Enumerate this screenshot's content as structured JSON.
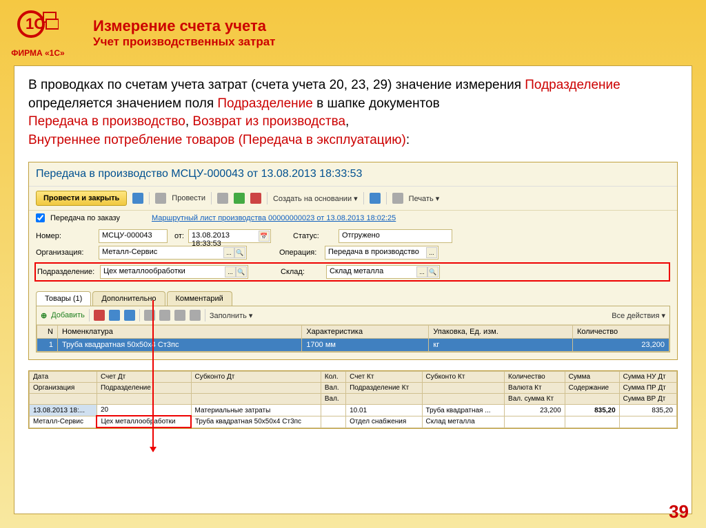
{
  "branding": {
    "company": "ФИРМА «1С»"
  },
  "header": {
    "title1": "Измерение счета учета",
    "title2": "Учет производственных затрат"
  },
  "intro": {
    "line1a": "В проводках по счетам учета затрат (счета учета 20, 23, 29) значение измерения ",
    "pod1": "Подразделение",
    "line1b": " определяется значением поля ",
    "pod2": "Подразделение",
    "line1c": " в шапке документов ",
    "doc1": "Передача в производство",
    "sep1": ", ",
    "doc2": "Возврат из производства",
    "sep2": ", ",
    "doc3": "Внутреннее потребление товаров (Передача в эксплуатацию)",
    "end": ":"
  },
  "window": {
    "title": "Передача в производство МСЦУ-000043 от 13.08.2013 18:33:53",
    "btn_post_close": "Провести и закрыть",
    "btn_post": "Провести",
    "btn_create_based": "Создать на основании ▾",
    "btn_print": "Печать ▾",
    "chk_by_order": "Передача по заказу",
    "route_link": "Маршрутный лист производства 00000000023 от 13.08.2013 18:02:25",
    "labels": {
      "number": "Номер:",
      "date": "от:",
      "status": "Статус:",
      "org": "Организация:",
      "operation": "Операция:",
      "dept": "Подразделение:",
      "warehouse": "Склад:"
    },
    "values": {
      "number": "МСЦУ-000043",
      "date": "13.08.2013 18:33:53",
      "status": "Отгружено",
      "org": "Металл-Сервис",
      "operation": "Передача в производство",
      "dept": "Цех металлообработки",
      "warehouse": "Склад металла"
    },
    "tabs": {
      "goods": "Товары (1)",
      "extra": "Дополнительно",
      "comment": "Комментарий"
    },
    "grid_toolbar": {
      "add": "Добавить",
      "fill": "Заполнить ▾",
      "all_actions": "Все действия ▾"
    },
    "grid": {
      "headers": {
        "n": "N",
        "item": "Номенклатура",
        "char": "Характеристика",
        "pack": "Упаковка, Ед. изм.",
        "qty": "Количество"
      },
      "row": {
        "n": "1",
        "item": "Труба квадратная 50x50x4 Ст3пс",
        "char": "1700 мм",
        "pack": "кг",
        "qty": "23,200"
      }
    }
  },
  "bottom": {
    "headers": {
      "date": "Дата",
      "acc_dt": "Счет Дт",
      "sub_dt": "Субконто Дт",
      "qty": "Кол.",
      "acc_kt": "Счет Кт",
      "sub_kt": "Субконто Кт",
      "qty2": "Количество",
      "sum": "Сумма",
      "sum_nu": "Сумма НУ Дт",
      "org": "Организация",
      "dept": "Подразделение",
      "curr": "Вал.",
      "dept_kt": "Подразделение Кт",
      "curr_kt": "Валюта Кт",
      "content": "Содержание",
      "sum_pr": "Сумма ПР Дт",
      "curr2": "Вал.",
      "curr_sum": "Вал. сумма Кт",
      "sum_vr": "Сумма ВР Дт"
    },
    "row": {
      "date": "13.08.2013 18:...",
      "acc_dt": "20",
      "sub_dt1": "Материальные затраты",
      "acc_kt": "10.01",
      "sub_kt1": "Труба квадратная ...",
      "qty": "23,200",
      "sum": "835,20",
      "sum_nu": "835,20",
      "org": "Металл-Сервис",
      "dept": "Цех металлообработки",
      "sub_dt2": "Труба квадратная 50x50x4 Ст3пс",
      "dept_kt": "Отдел снабжения",
      "sub_kt2": "Склад металла"
    }
  },
  "page_num": "39"
}
